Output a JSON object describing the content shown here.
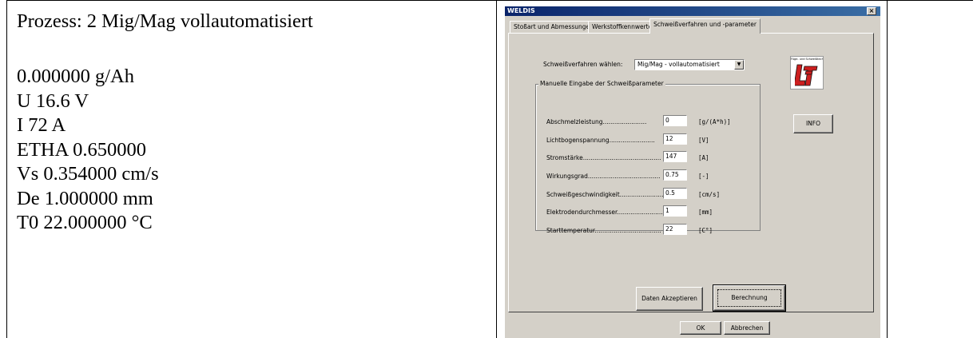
{
  "document": {
    "top_clipped_text": "Prozess: 2",
    "lines": [
      "Prozess: 2 Mig/Mag vollautomatisiert",
      "",
      "0.000000 g/Ah",
      "U 16.6 V",
      "I 72 A",
      "ETHA 0.650000",
      "Vs 0.354000 cm/s",
      "De 1.000000 mm",
      "T0 22.000000 °C"
    ]
  },
  "window": {
    "title": "WELDIS",
    "close_glyph": "×",
    "tabs": [
      {
        "label": "Stoßart und Abmessungen",
        "active": false
      },
      {
        "label": "Werkstoffkennwerte",
        "active": false
      },
      {
        "label": "Schweißverfahren und -parameter",
        "active": true
      }
    ],
    "process_label": "Schweißverfahren wählen:",
    "process_value": "Mig/Mag - vollautomatisiert",
    "combo_arrow": "▼",
    "group_title": "Manuelle Eingabe der Schweißparameter",
    "params": [
      {
        "label": "Abschmelzleistung.......................",
        "value": "0",
        "unit": "[g/(A*h)]"
      },
      {
        "label": "Lichtbogenspannung........................",
        "value": "12",
        "unit": "[V]"
      },
      {
        "label": "Stromstärke.........................................",
        "value": "147",
        "unit": "[A]"
      },
      {
        "label": "Wirkungsgrad......................................",
        "value": "0.75",
        "unit": "[-]"
      },
      {
        "label": "Schweißgeschwindigkeit........................",
        "value": "0.5",
        "unit": "[cm/s]"
      },
      {
        "label": "Elektrodendurchmesser...........................",
        "value": "1",
        "unit": "[mm]"
      },
      {
        "label": "Starttemperatur...................................",
        "value": "22",
        "unit": "[C°]"
      }
    ],
    "logo": {
      "caption": "Füge- und Schweißtechnik",
      "mark": "LFT",
      "color": "#cc1f1f"
    },
    "info_button": "INFO",
    "accept_button": "Daten Akzeptieren",
    "calc_button": "Berechnung",
    "ok_button": "OK",
    "cancel_button": "Abbrechen"
  }
}
